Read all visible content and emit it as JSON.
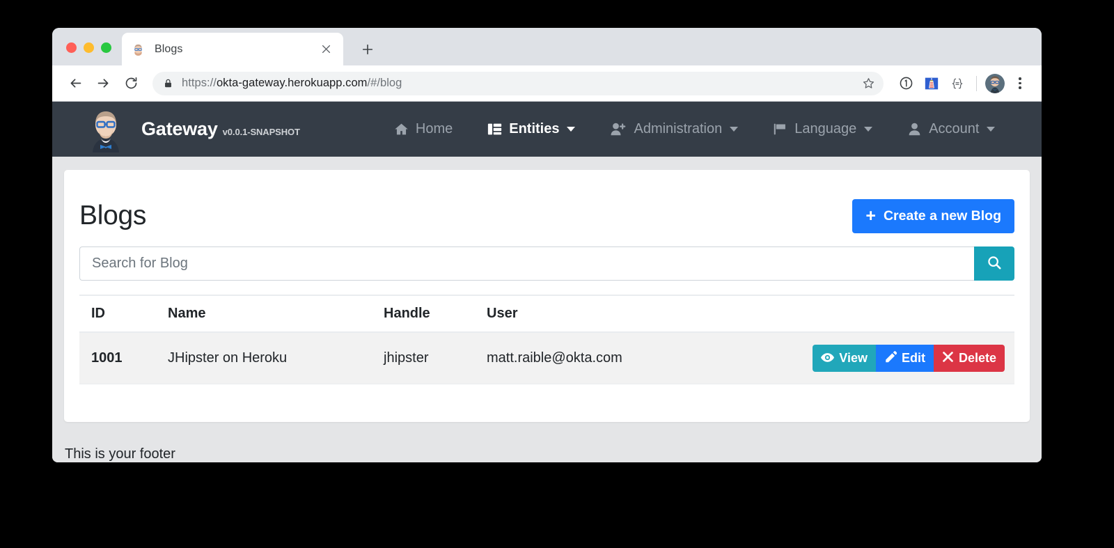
{
  "browser": {
    "tab": {
      "title": "Blogs",
      "favicon_icon": "jhipster-mascot-icon",
      "close_icon": "close-icon"
    },
    "new_tab_label": "+",
    "back_icon": "back-arrow-icon",
    "forward_icon": "forward-arrow-icon",
    "reload_icon": "reload-icon",
    "lock_icon": "lock-icon",
    "url": {
      "scheme": "https://",
      "host": "okta-gateway.herokuapp.com",
      "path": "/#/blog"
    },
    "star_icon": "star-icon",
    "extensions": [
      {
        "name": "info-circle-icon"
      },
      {
        "name": "lighthouse-icon"
      },
      {
        "name": "braces-icon"
      }
    ],
    "profile_icon": "profile-avatar",
    "menu_icon": "kebab-menu-icon"
  },
  "navbar": {
    "brand": {
      "logo_icon": "jhipster-mascot-logo",
      "name": "Gateway",
      "version": "v0.0.1-SNAPSHOT"
    },
    "items": [
      {
        "label": "Home",
        "icon": "home-icon",
        "active": false,
        "caret": false
      },
      {
        "label": "Entities",
        "icon": "list-icon",
        "active": true,
        "caret": true
      },
      {
        "label": "Administration",
        "icon": "user-plus-icon",
        "active": false,
        "caret": true
      },
      {
        "label": "Language",
        "icon": "flag-icon",
        "active": false,
        "caret": true
      },
      {
        "label": "Account",
        "icon": "user-icon",
        "active": false,
        "caret": true
      }
    ],
    "background": "#353d47"
  },
  "page": {
    "title": "Blogs",
    "create_button": {
      "label": "Create a new Blog",
      "icon": "plus-icon",
      "color": "#1b79fd"
    },
    "search": {
      "placeholder": "Search for Blog",
      "value": "",
      "button_icon": "search-icon",
      "button_color": "#17a2b8"
    },
    "table": {
      "columns": [
        "ID",
        "Name",
        "Handle",
        "User"
      ],
      "rows": [
        {
          "id": "1001",
          "name": "JHipster on Heroku",
          "handle": "jhipster",
          "user": "matt.raible@okta.com",
          "actions": [
            {
              "label": "View",
              "icon": "eye-icon",
              "color": "#21a7ba"
            },
            {
              "label": "Edit",
              "icon": "pencil-icon",
              "color": "#1b79fd"
            },
            {
              "label": "Delete",
              "icon": "times-icon",
              "color": "#dc3545"
            }
          ]
        }
      ]
    },
    "footer": "This is your footer"
  }
}
